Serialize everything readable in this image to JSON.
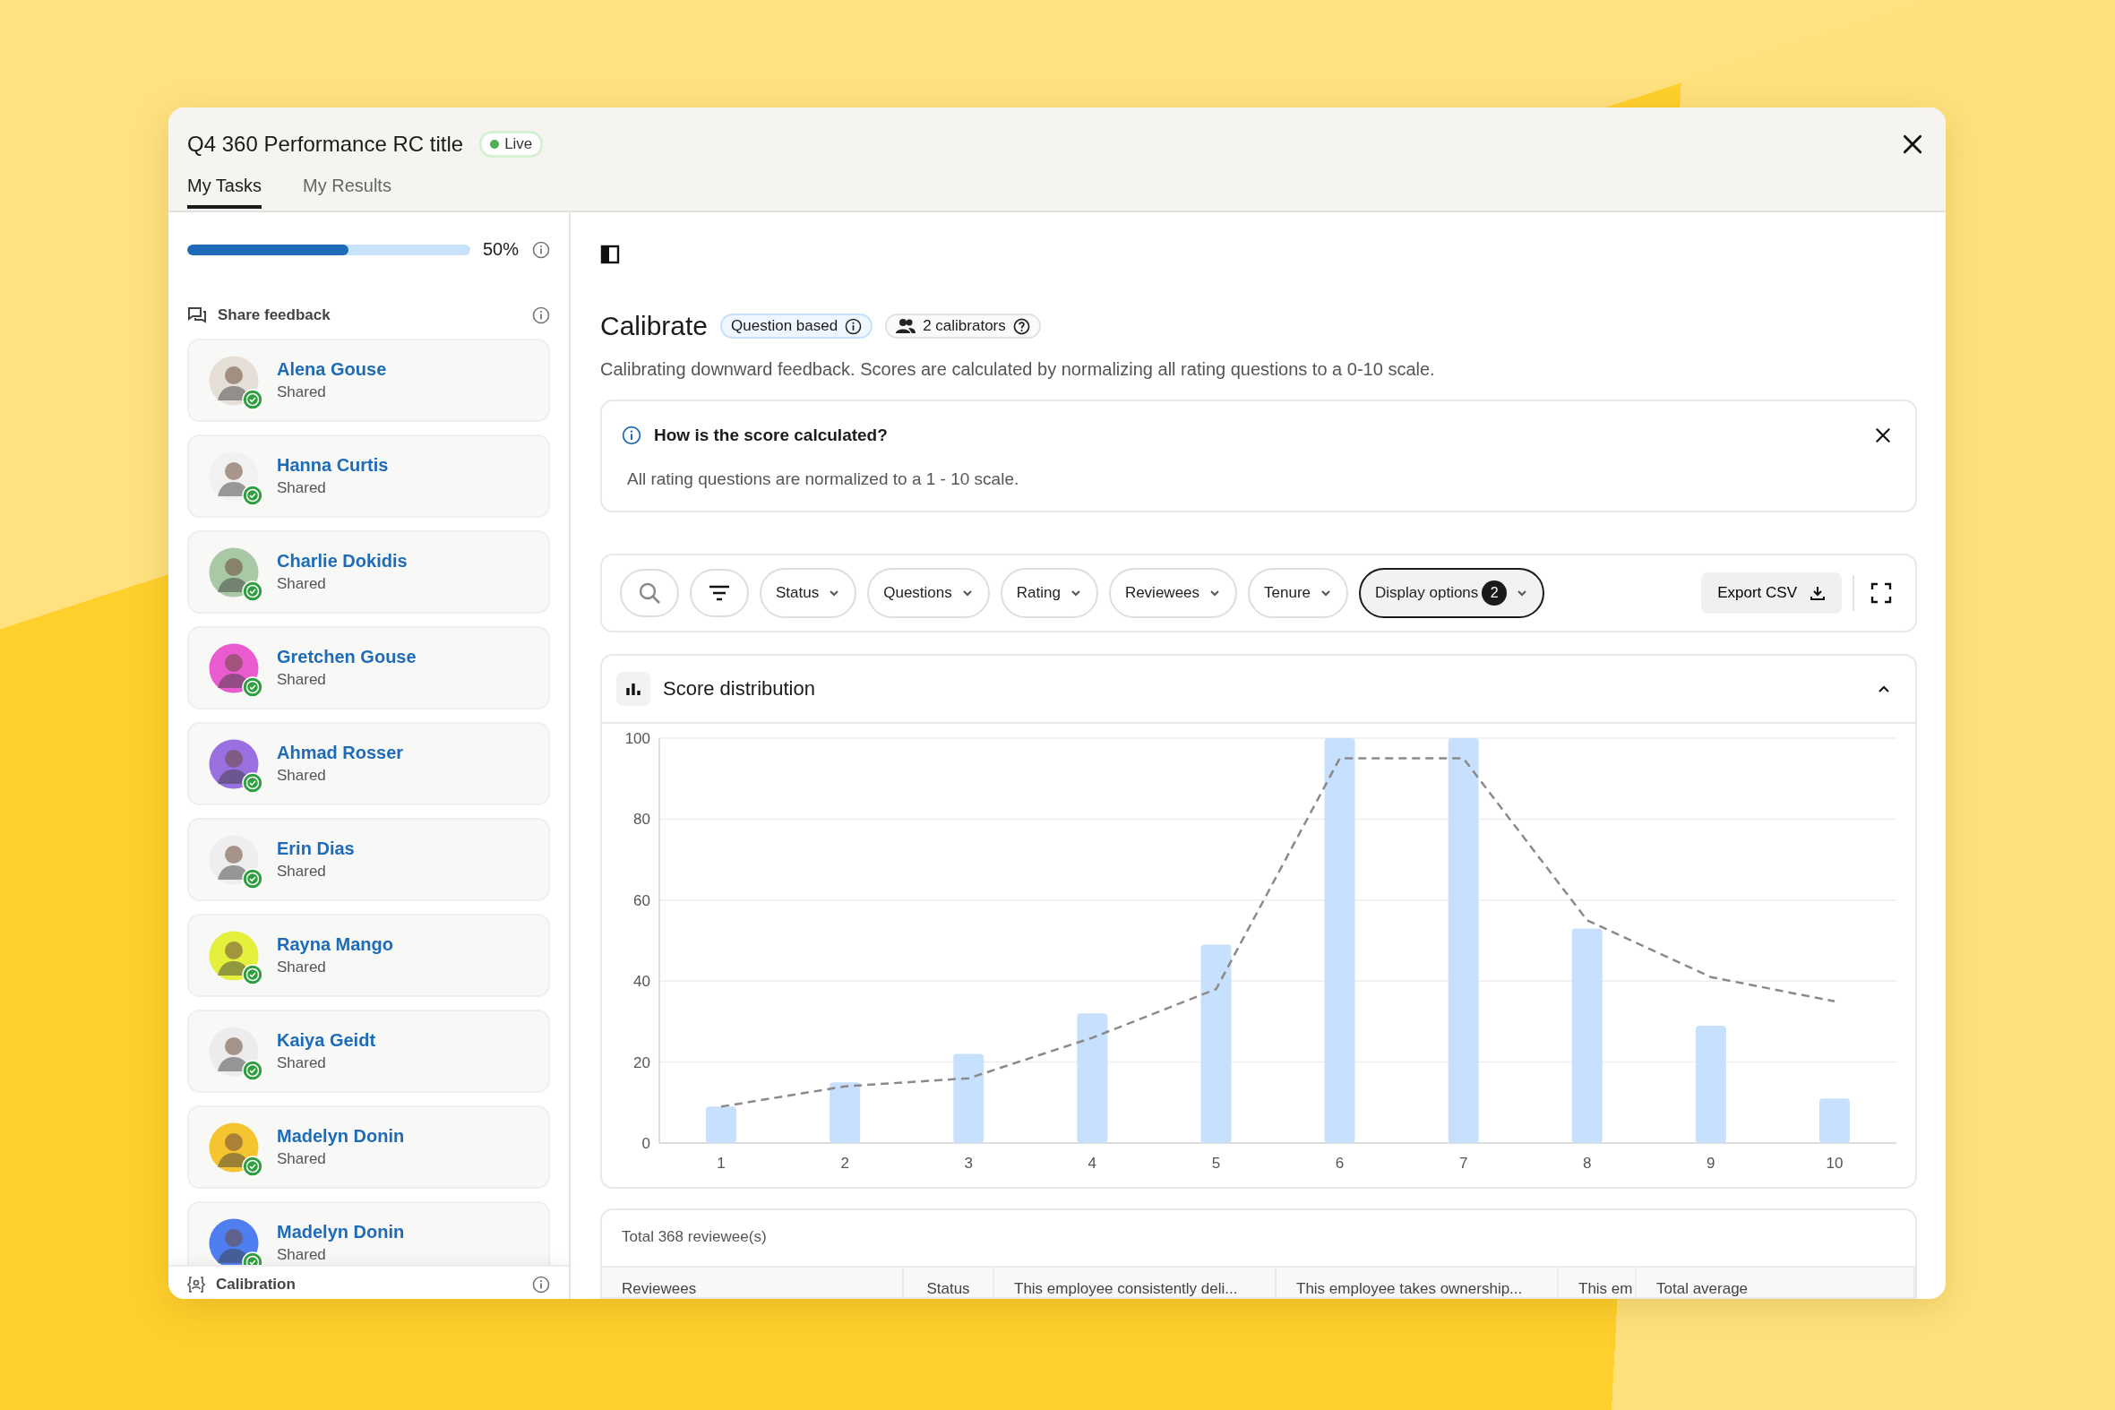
{
  "window": {
    "title": "Q4 360 Performance RC title",
    "status_badge": "Live"
  },
  "tabs": [
    {
      "label": "My Tasks",
      "selected": true
    },
    {
      "label": "My Results",
      "selected": false
    }
  ],
  "sidebar": {
    "progress": {
      "level": 0.57,
      "reading": "50%"
    },
    "section_title": "Share feedback",
    "people": [
      {
        "name": "Alena Gouse",
        "status": "Shared",
        "color": "#e6dfd8"
      },
      {
        "name": "Hanna Curtis",
        "status": "Shared",
        "color": "#f1f1f1"
      },
      {
        "name": "Charlie Dokidis",
        "status": "Shared",
        "color": "#a9c8a6"
      },
      {
        "name": "Gretchen Gouse",
        "status": "Shared",
        "color": "#ea5bd0"
      },
      {
        "name": "Ahmad Rosser",
        "status": "Shared",
        "color": "#9a6fe0"
      },
      {
        "name": "Erin Dias",
        "status": "Shared",
        "color": "#eeeeee"
      },
      {
        "name": "Rayna Mango",
        "status": "Shared",
        "color": "#e4f03c"
      },
      {
        "name": "Kaiya Geidt",
        "status": "Shared",
        "color": "#ececec"
      },
      {
        "name": "Madelyn Donin",
        "status": "Shared",
        "color": "#f6c431"
      },
      {
        "name": "Madelyn Donin",
        "status": "Shared",
        "color": "#4f7ef0"
      }
    ],
    "footer_title": "Calibration"
  },
  "main": {
    "heading": "Calibrate",
    "tags": [
      {
        "kind": "info",
        "label": "Question based"
      },
      {
        "kind": "people",
        "label": "2 calibrators"
      }
    ],
    "description": "Calibrating downward feedback. Scores are calculated by normalizing all rating questions to a 0-10 scale.",
    "info_box": {
      "title": "How is the score calculated?",
      "text": "All rating questions are normalized to a 1 - 10 scale."
    },
    "filters": [
      {
        "label": "Status",
        "active": false
      },
      {
        "label": "Questions",
        "active": false
      },
      {
        "label": "Rating",
        "active": false
      },
      {
        "label": "Reviewees",
        "active": false
      },
      {
        "label": "Tenure",
        "active": false
      },
      {
        "label": "Display options",
        "active": true,
        "count": "2"
      }
    ],
    "export_button": "Export CSV",
    "chart_card": {
      "title": "Score distribution",
      "expanded": true,
      "chart_data": {
        "type": "bar",
        "categories": [
          "1",
          "2",
          "3",
          "4",
          "5",
          "6",
          "7",
          "8",
          "9",
          "10"
        ],
        "ylim": [
          0,
          100
        ],
        "yticks": [
          0,
          20,
          40,
          60,
          80,
          100
        ],
        "grid": true,
        "series": [
          {
            "type": "bar",
            "color": "#c7e0fd",
            "values": [
              9,
              15,
              22,
              32,
              49,
              100,
              100,
              53,
              29,
              11
            ]
          },
          {
            "type": "line",
            "line_style": "dashed",
            "color": "#8a8a8a",
            "values": [
              9,
              14,
              16,
              26,
              38,
              95,
              95,
              55,
              41,
              35
            ]
          }
        ]
      }
    },
    "table": {
      "total": "Total 368 reviewee(s)",
      "columns": [
        "Reviewees",
        "Status",
        "This employee consistently deli...",
        "This employee takes ownership...",
        "This em",
        "Total average"
      ]
    }
  }
}
